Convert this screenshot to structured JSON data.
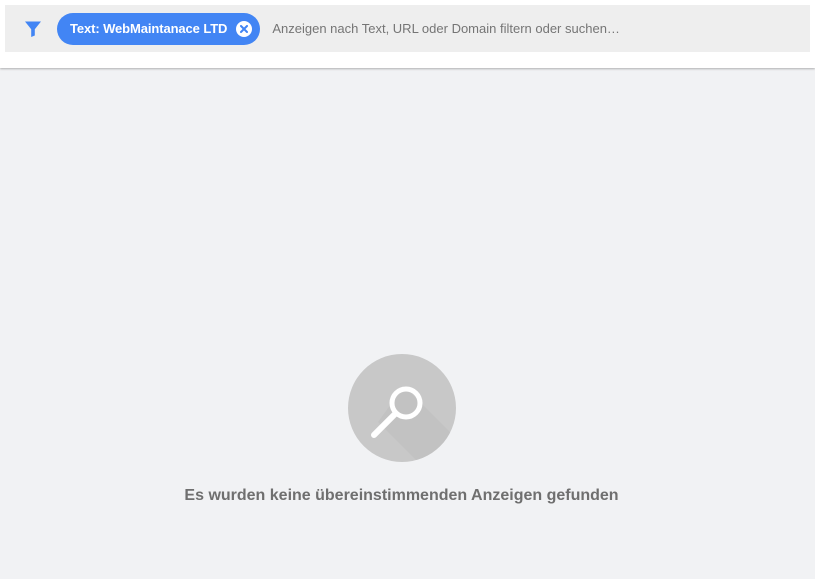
{
  "filter_bar": {
    "filter_icon": "filter-funnel-icon",
    "chip": {
      "label": "Text: WebMaintanace LTD",
      "close_icon": "close-circle-icon"
    },
    "search": {
      "placeholder": "Anzeigen nach Text, URL oder Domain filtern oder suchen…",
      "value": ""
    }
  },
  "empty_state": {
    "icon": "magnifier-icon",
    "message": "Es wurden keine übereinstimmenden Anzeigen gefunden"
  },
  "colors": {
    "accent": "#4285f4",
    "filter_bar_bg": "#eeeeee",
    "page_bg": "#f1f2f4",
    "empty_icon_bg": "#c8c8c8",
    "message_text": "#6f6f6f"
  }
}
